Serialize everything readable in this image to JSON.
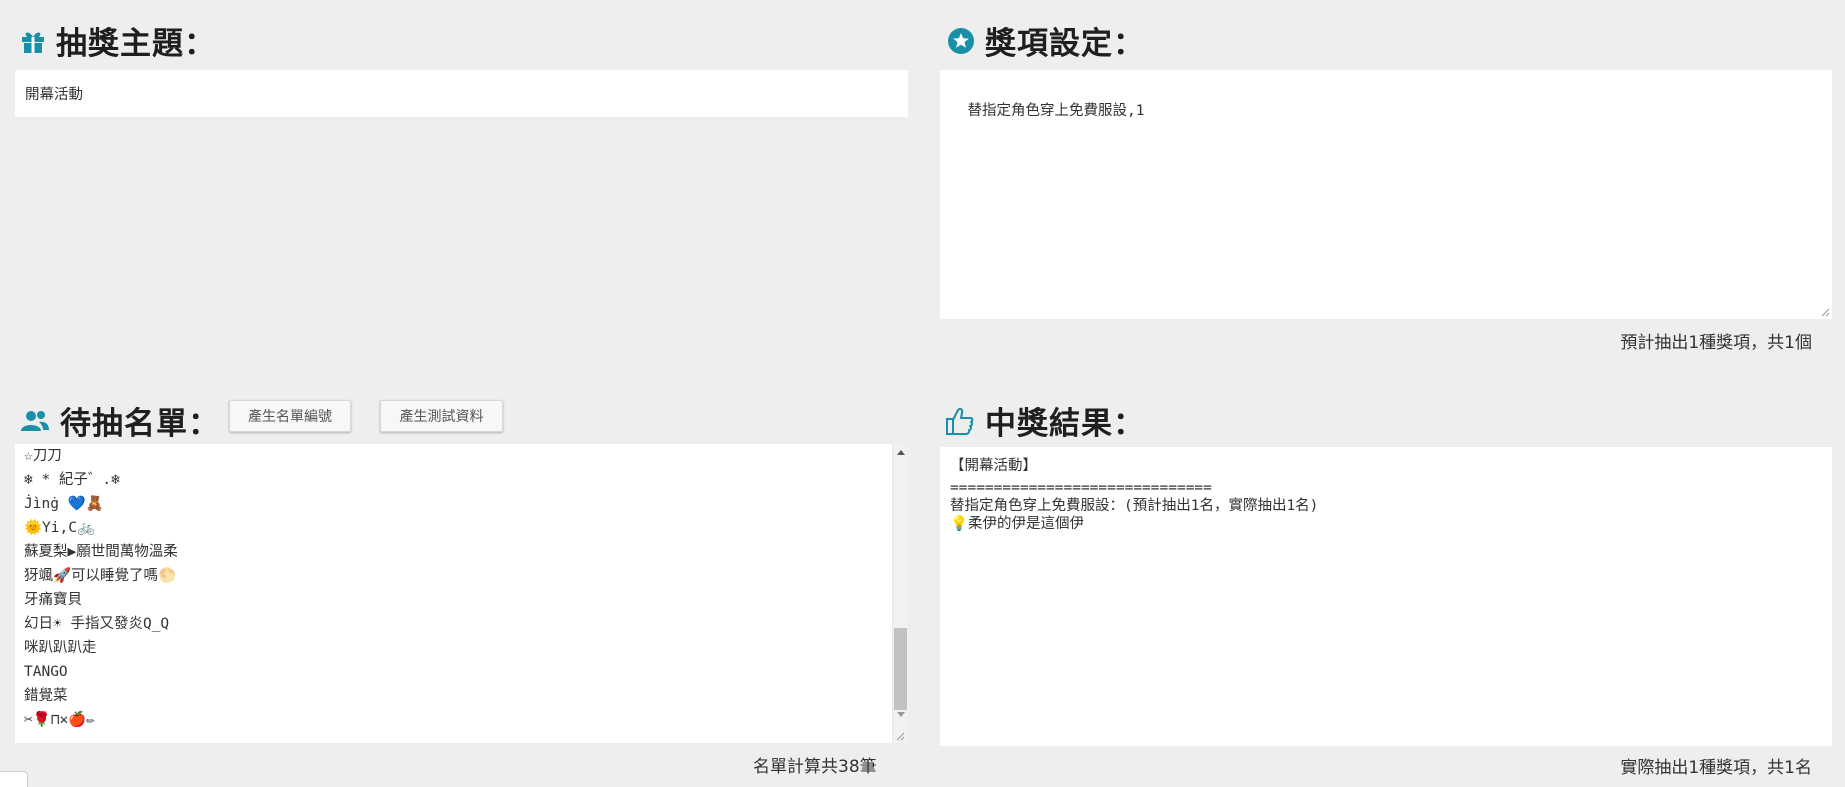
{
  "topic": {
    "title": "抽獎主題：",
    "icon": "gift-icon",
    "value": "開幕活動"
  },
  "prizes": {
    "title": "獎項設定：",
    "icon": "star-circle-icon",
    "value": "替指定角色穿上免費服設,1",
    "summary": "預計抽出1種獎項，共1個"
  },
  "participants": {
    "title": "待抽名單：",
    "icon": "users-icon",
    "generate_ids_button": "產生名單編號",
    "generate_test_button": "產生測試資料",
    "visible_lines": [
      "☆刀刀",
      "❄ * 紀子゛.❄",
      "J̇ìnġ 💙🧸",
      "🌞Yi,C🚲",
      "蘇夏梨▶願世間萬物溫柔",
      "犽颯🚀可以睡覺了嗎🌕",
      "牙痛寶貝",
      "幻日☀ 手指又發炎Q_Q",
      "咪趴趴趴走",
      "TANGO",
      "錯覺菜",
      "✂🌹⊓✕🍎✏"
    ],
    "count_note": "名單計算共38筆"
  },
  "results": {
    "title": "中獎結果：",
    "icon": "thumbs-up-icon",
    "lines": [
      "【開幕活動】",
      "==============================",
      "替指定角色穿上免費服設：(預計抽出1名，實際抽出1名)",
      "💡柔伊的伊是這個伊"
    ],
    "summary": "實際抽出1種獎項，共1名"
  },
  "colors": {
    "accent": "#1a8fa8",
    "background": "#eeeeee"
  }
}
